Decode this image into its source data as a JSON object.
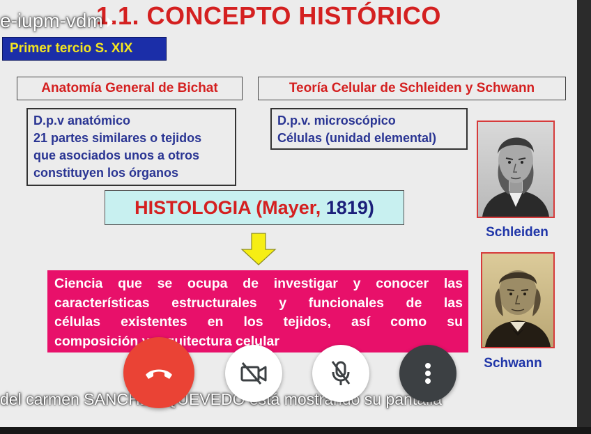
{
  "meeting": {
    "tile_label": "e-iupm-vdm",
    "presenter_notice": "del carmen SANCHEZ QUEVEDO está mostrando su pantalla"
  },
  "slide": {
    "title": "1.1. CONCEPTO HISTÓRICO",
    "period": "Primer tercio S. XIX",
    "left_heading": "Anatomía General de Bichat",
    "right_heading": "Teoría Celular de Schleiden y Schwann",
    "left_box_lines": [
      "D.p.v anatómico",
      "21 partes similares o tejidos",
      "que asociados unos a otros",
      "constituyen los órganos"
    ],
    "right_box_lines": [
      "D.p.v. microscópico",
      "Células (unidad elemental)"
    ],
    "histology_word": "HISTOLOGIA",
    "histology_author": "(Mayer,",
    "histology_year": "1819)",
    "definition_lines": [
      "Ciencia que se ocupa de investigar y conocer las",
      "características estructurales y funcionales de las",
      "células existentes en los tejidos, así como su",
      "composición y arquitectura celular"
    ],
    "portrait_top_caption": "Schleiden",
    "portrait_bottom_caption": "Schwann"
  },
  "controls": {
    "hangup_icon": "phone-hangup-icon",
    "camera_icon": "camera-off-icon",
    "mic_icon": "mic-off-icon",
    "more_icon": "more-vert-icon"
  },
  "colors": {
    "title_red": "#d42020",
    "period_bg": "#1b2ea8",
    "period_text": "#f3e520",
    "box_text_blue": "#2a3593",
    "histology_bg": "#c8f0f0",
    "definition_bg": "#e8106a",
    "arrow_yellow": "#f6ee14",
    "hangup_red": "#ea4335",
    "control_dark": "#3c4043"
  }
}
